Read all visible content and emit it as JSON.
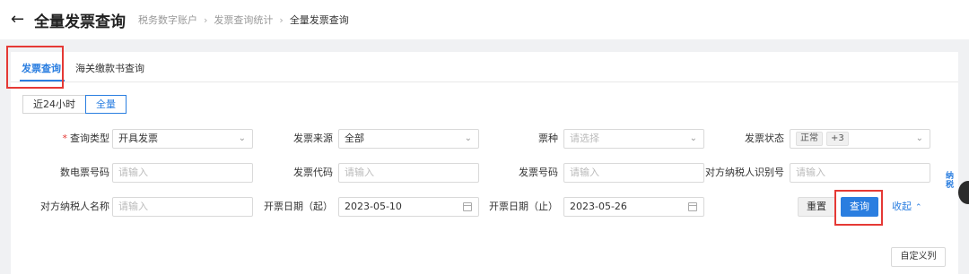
{
  "header": {
    "back_icon": "arrow-left-icon",
    "title": "全量发票查询",
    "breadcrumb": [
      "税务数字账户",
      "发票查询统计",
      "全量发票查询"
    ]
  },
  "tabs": [
    {
      "label": "发票查询",
      "active": true
    },
    {
      "label": "海关缴款书查询",
      "active": false
    }
  ],
  "period": {
    "options": [
      "近24小时",
      "全量"
    ],
    "selected": "全量"
  },
  "form": {
    "row1": {
      "query_type": {
        "label": "查询类型",
        "value": "开具发票"
      },
      "invoice_source": {
        "label": "发票来源",
        "value": "全部"
      },
      "ticket_type": {
        "label": "票种",
        "placeholder": "请选择"
      },
      "invoice_status": {
        "label": "发票状态",
        "tag": "正常",
        "extra": "+3"
      }
    },
    "row2": {
      "digital_number": {
        "label": "数电票号码",
        "placeholder": "请输入"
      },
      "invoice_code": {
        "label": "发票代码",
        "placeholder": "请输入"
      },
      "invoice_number": {
        "label": "发票号码",
        "placeholder": "请输入"
      },
      "counterparty_id": {
        "label": "对方纳税人识别号",
        "placeholder": "请输入"
      }
    },
    "row3": {
      "counterparty_name": {
        "label": "对方纳税人名称",
        "placeholder": "请输入"
      },
      "date_start": {
        "label": "开票日期（起）",
        "value": "2023-05-10"
      },
      "date_end": {
        "label": "开票日期（止）",
        "value": "2023-05-26"
      }
    }
  },
  "actions": {
    "reset": "重置",
    "query": "查询",
    "collapse": "收起"
  },
  "custom_columns": "自定义列",
  "floating": {
    "label": "纳税",
    "icon": "assistant-avatar-icon"
  },
  "colors": {
    "accent": "#2a7ee0",
    "highlight": "#e53935"
  }
}
